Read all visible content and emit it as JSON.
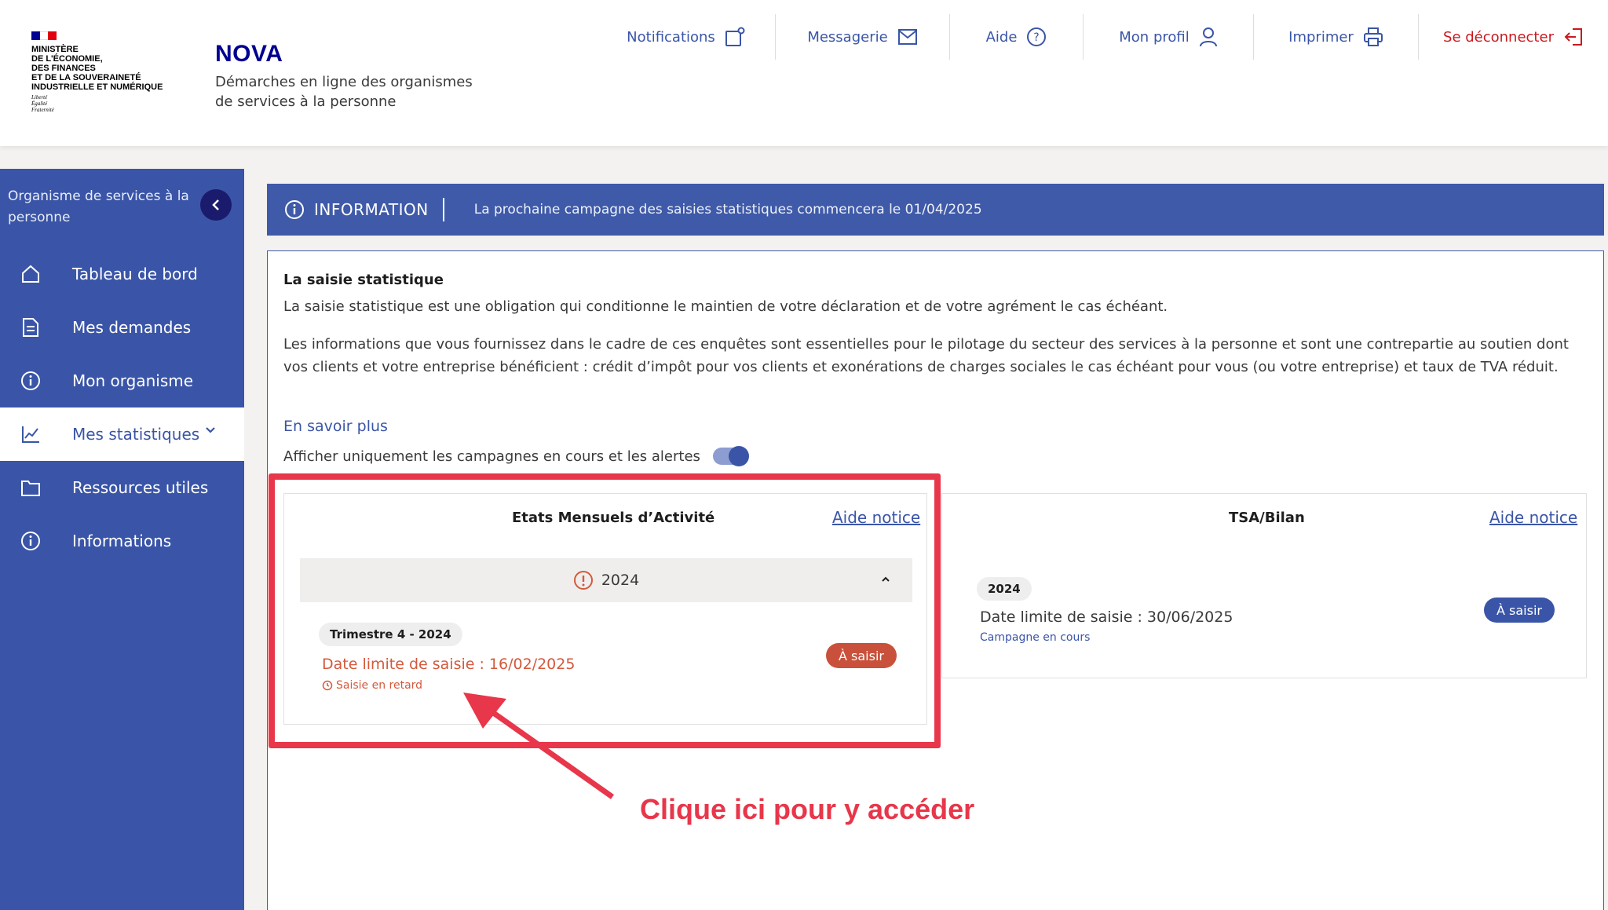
{
  "header": {
    "logo_lines": [
      "Ministère",
      "de l'économie,",
      "des finances",
      "et de la souveraineté",
      "industrielle et numérique"
    ],
    "logo_motto": [
      "Liberté",
      "Égalité",
      "Fraternité"
    ],
    "brand_name": "NOVA",
    "brand_tagline": "Démarches en ligne des organismes de services à la personne",
    "nav": [
      {
        "label": "Notifications",
        "icon": "notification-icon"
      },
      {
        "label": "Messagerie",
        "icon": "mail-icon"
      },
      {
        "label": "Aide",
        "icon": "help-icon"
      },
      {
        "label": "Mon profil",
        "icon": "user-icon"
      },
      {
        "label": "Imprimer",
        "icon": "printer-icon"
      },
      {
        "label": "Se déconnecter",
        "icon": "logout-icon"
      }
    ],
    "logout_color": "#c9191e",
    "flag_colors": [
      "#000091",
      "#ffffff",
      "#e1000f"
    ]
  },
  "sidebar": {
    "title": "Organisme de services à la personne",
    "items": [
      {
        "label": "Tableau de bord",
        "icon": "home-icon"
      },
      {
        "label": "Mes demandes",
        "icon": "document-icon"
      },
      {
        "label": "Mon organisme",
        "icon": "info-icon"
      },
      {
        "label": "Mes statistiques",
        "icon": "chart-icon"
      },
      {
        "label": "Ressources utiles",
        "icon": "folder-icon"
      },
      {
        "label": "Informations",
        "icon": "info-icon"
      }
    ],
    "active_index": 3,
    "background_color": "#3a55a7"
  },
  "banner": {
    "label": "INFORMATION",
    "message": "La prochaine campagne des saisies statistiques commencera le 01/04/2025"
  },
  "intro": {
    "title": "La saisie statistique",
    "paragraph1": "La saisie statistique est une obligation qui conditionne le maintien de votre déclaration et de votre agrément le cas échéant.",
    "paragraph2": "Les informations que vous fournissez dans le cadre de ces enquêtes sont essentielles pour le pilotage du secteur des services à la personne et sont une contrepartie au soutien dont vos clients et votre entreprise bénéficient : crédit d’impôt pour vos clients et exonérations de charges sociales le cas échéant pour vous (ou votre entreprise) et taux de TVA réduit.",
    "more_link": "En savoir plus",
    "toggle_label": "Afficher uniquement les campagnes en cours et les alertes"
  },
  "cards": {
    "ema": {
      "title": "Etats Mensuels d’Activité",
      "aide": "Aide notice",
      "year": "2024",
      "period": "Trimestre 4 - 2024",
      "deadline": "Date limite de saisie : 16/02/2025",
      "status": "Saisie en retard",
      "action": "À saisir"
    },
    "tsa": {
      "title": "TSA/Bilan",
      "aide": "Aide notice",
      "period": "2024",
      "deadline": "Date limite de saisie : 30/06/2025",
      "status": "Campagne en cours",
      "action": "À saisir"
    }
  },
  "annotation": {
    "callout": "Clique ici pour y accéder",
    "color": "#e8364a"
  }
}
